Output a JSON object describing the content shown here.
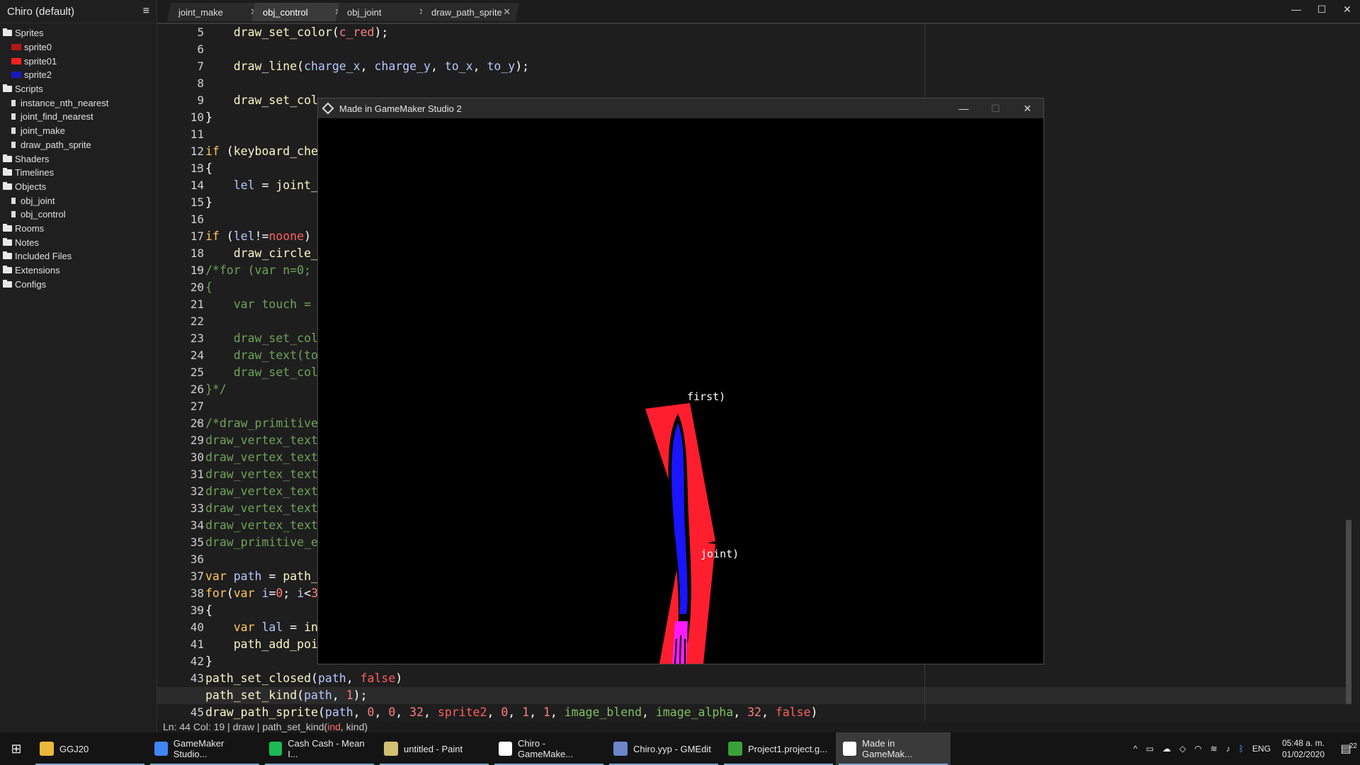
{
  "sidebar": {
    "project_title": "Chiro (default)",
    "groups": [
      {
        "label": "Sprites",
        "children": [
          {
            "label": "sprite0",
            "thumb": "#b01818"
          },
          {
            "label": "sprite01",
            "thumb": "#ff2020"
          },
          {
            "label": "sprite2",
            "thumb": "#1818c0"
          }
        ]
      },
      {
        "label": "Scripts",
        "children": [
          {
            "label": "instance_nth_nearest"
          },
          {
            "label": "joint_find_nearest"
          },
          {
            "label": "joint_make"
          },
          {
            "label": "draw_path_sprite"
          }
        ]
      },
      {
        "label": "Shaders",
        "children": []
      },
      {
        "label": "Timelines",
        "children": []
      },
      {
        "label": "Objects",
        "children": [
          {
            "label": "obj_joint"
          },
          {
            "label": "obj_control"
          }
        ]
      },
      {
        "label": "Rooms",
        "children": []
      },
      {
        "label": "Notes",
        "children": []
      },
      {
        "label": "Included Files",
        "children": []
      },
      {
        "label": "Extensions",
        "children": []
      },
      {
        "label": "Configs",
        "children": []
      }
    ]
  },
  "tabs": [
    {
      "label": "joint_make",
      "active": false
    },
    {
      "label": "obj_control",
      "active": true
    },
    {
      "label": "obj_joint",
      "active": false
    },
    {
      "label": "draw_path_sprite",
      "active": false
    }
  ],
  "editor": {
    "current_line": 44,
    "lines": [
      {
        "n": 5,
        "fold": false,
        "html": "    <span class=\"fn\">draw_set_color</span>(<span class=\"cst\">c_red</span>);"
      },
      {
        "n": 6,
        "fold": false,
        "html": ""
      },
      {
        "n": 7,
        "fold": false,
        "html": "    <span class=\"fn\">draw_line</span>(<span class=\"var\">charge_x</span>, <span class=\"var\">charge_y</span>, <span class=\"var\">to_x</span>, <span class=\"var\">to_y</span>);"
      },
      {
        "n": 8,
        "fold": false,
        "html": ""
      },
      {
        "n": 9,
        "fold": false,
        "html": "    <span class=\"fn\">draw_set_col</span>"
      },
      {
        "n": 10,
        "fold": false,
        "html": "}"
      },
      {
        "n": 11,
        "fold": false,
        "html": ""
      },
      {
        "n": 12,
        "fold": false,
        "html": "<span class=\"kw\">if</span> (<span class=\"fn\">keyboard_che</span>"
      },
      {
        "n": 13,
        "fold": true,
        "html": "{"
      },
      {
        "n": 14,
        "fold": false,
        "html": "    <span class=\"var\">lel</span> = <span class=\"fn\">joint_</span>"
      },
      {
        "n": 15,
        "fold": false,
        "html": "}"
      },
      {
        "n": 16,
        "fold": false,
        "html": ""
      },
      {
        "n": 17,
        "fold": false,
        "html": "<span class=\"kw\">if</span> (<span class=\"var\">lel</span>!=<span class=\"res\">noone</span>)"
      },
      {
        "n": 18,
        "fold": false,
        "html": "    <span class=\"fn\">draw_circle_</span>"
      },
      {
        "n": 19,
        "fold": true,
        "html": "<span class=\"cm\">/*for (var n=0;</span>"
      },
      {
        "n": 20,
        "fold": true,
        "html": "<span class=\"cm\">{</span>"
      },
      {
        "n": 21,
        "fold": false,
        "html": "<span class=\"cm\">    var touch =</span>"
      },
      {
        "n": 22,
        "fold": false,
        "html": ""
      },
      {
        "n": 23,
        "fold": false,
        "html": "<span class=\"cm\">    draw_set_col</span>"
      },
      {
        "n": 24,
        "fold": false,
        "html": "<span class=\"cm\">    draw_text(to</span>"
      },
      {
        "n": 25,
        "fold": false,
        "html": "<span class=\"cm\">    draw_set_col</span>"
      },
      {
        "n": 26,
        "fold": false,
        "html": "<span class=\"cm\">}*/</span>"
      },
      {
        "n": 27,
        "fold": false,
        "html": ""
      },
      {
        "n": 28,
        "fold": true,
        "html": "<span class=\"cm\">/*draw_primitive</span>"
      },
      {
        "n": 29,
        "fold": false,
        "html": "<span class=\"cm\">draw_vertex_text</span>"
      },
      {
        "n": 30,
        "fold": false,
        "html": "<span class=\"cm\">draw_vertex_text</span>"
      },
      {
        "n": 31,
        "fold": false,
        "html": "<span class=\"cm\">draw_vertex_text</span>"
      },
      {
        "n": 32,
        "fold": false,
        "html": "<span class=\"cm\">draw_vertex_text</span>"
      },
      {
        "n": 33,
        "fold": false,
        "html": "<span class=\"cm\">draw_vertex_text</span>"
      },
      {
        "n": 34,
        "fold": false,
        "html": "<span class=\"cm\">draw_vertex_text</span>"
      },
      {
        "n": 35,
        "fold": false,
        "html": "<span class=\"cm\">draw_primitive_e</span>"
      },
      {
        "n": 36,
        "fold": false,
        "html": ""
      },
      {
        "n": 37,
        "fold": false,
        "html": "<span class=\"kw\">var</span> <span class=\"var\">path</span> = <span class=\"fn\">path_</span>"
      },
      {
        "n": 38,
        "fold": false,
        "html": "<span class=\"kw\">for</span>(<span class=\"kw\">var</span> <span class=\"var\">i</span>=<span class=\"num\">0</span>; <span class=\"var\">i</span>&lt;<span class=\"num\">3</span>"
      },
      {
        "n": 39,
        "fold": true,
        "html": "{"
      },
      {
        "n": 40,
        "fold": false,
        "html": "    <span class=\"kw\">var</span> <span class=\"var\">lal</span> = <span class=\"fn\">in</span>"
      },
      {
        "n": 41,
        "fold": false,
        "html": "    <span class=\"fn\">path_add_poi</span>"
      },
      {
        "n": 42,
        "fold": false,
        "html": "}"
      },
      {
        "n": 43,
        "fold": false,
        "html": "<span class=\"fn\">path_set_closed</span>(<span class=\"var\">path</span>, <span class=\"res\">false</span>)"
      },
      {
        "n": 44,
        "fold": false,
        "html": "<span class=\"fn\">path_set_kind</span>(<span class=\"var\">path</span>, <span class=\"num\">1</span>);"
      },
      {
        "n": 45,
        "fold": false,
        "html": "<span class=\"fn\">draw_path_sprite</span>(<span class=\"var\">path</span>, <span class=\"num\">0</span>, <span class=\"num\">0</span>, <span class=\"num\">32</span>, <span class=\"res\">sprite2</span>, <span class=\"num\">0</span>, <span class=\"num\">1</span>, <span class=\"num\">1</span>, <span class=\"bi\">image_blend</span>, <span class=\"bi\">image_alpha</span>, <span class=\"num\">32</span>, <span class=\"res\">false</span>)"
      }
    ]
  },
  "statusbar": {
    "text": "Ln:  44 Col:  19 | draw | path_set_kind(",
    "arg1": "ind",
    "rest": ", kind)"
  },
  "game_window": {
    "title": "Made in GameMaker Studio 2",
    "label_first": "first)",
    "label_joint": "joint)"
  },
  "taskbar": {
    "items": [
      {
        "label": "GGJ20",
        "icon": "folder-icon",
        "color": "#e8b93a",
        "state": "running"
      },
      {
        "label": "GameMaker Studio...",
        "icon": "chrome-icon",
        "color": "#4285f4",
        "state": "running"
      },
      {
        "label": "Cash Cash - Mean I...",
        "icon": "spotify-icon",
        "color": "#1db954",
        "state": "running"
      },
      {
        "label": "untitled - Paint",
        "icon": "paint-icon",
        "color": "#d0c070",
        "state": "running"
      },
      {
        "label": "Chiro - GameMake...",
        "icon": "gamemaker-icon",
        "color": "#ffffff",
        "state": "running"
      },
      {
        "label": "Chiro.yyp - GMEdit",
        "icon": "gmedit-icon",
        "color": "#6a86c8",
        "state": "running"
      },
      {
        "label": "Project1.project.g...",
        "icon": "gm-project-icon",
        "color": "#3aa03a",
        "state": "running"
      },
      {
        "label": "Made in GameMak...",
        "icon": "gamemaker-icon",
        "color": "#ffffff",
        "state": "active"
      }
    ],
    "language": "ENG",
    "time": "05:48 a. m.",
    "date": "01/02/2020",
    "notifications": "22"
  }
}
